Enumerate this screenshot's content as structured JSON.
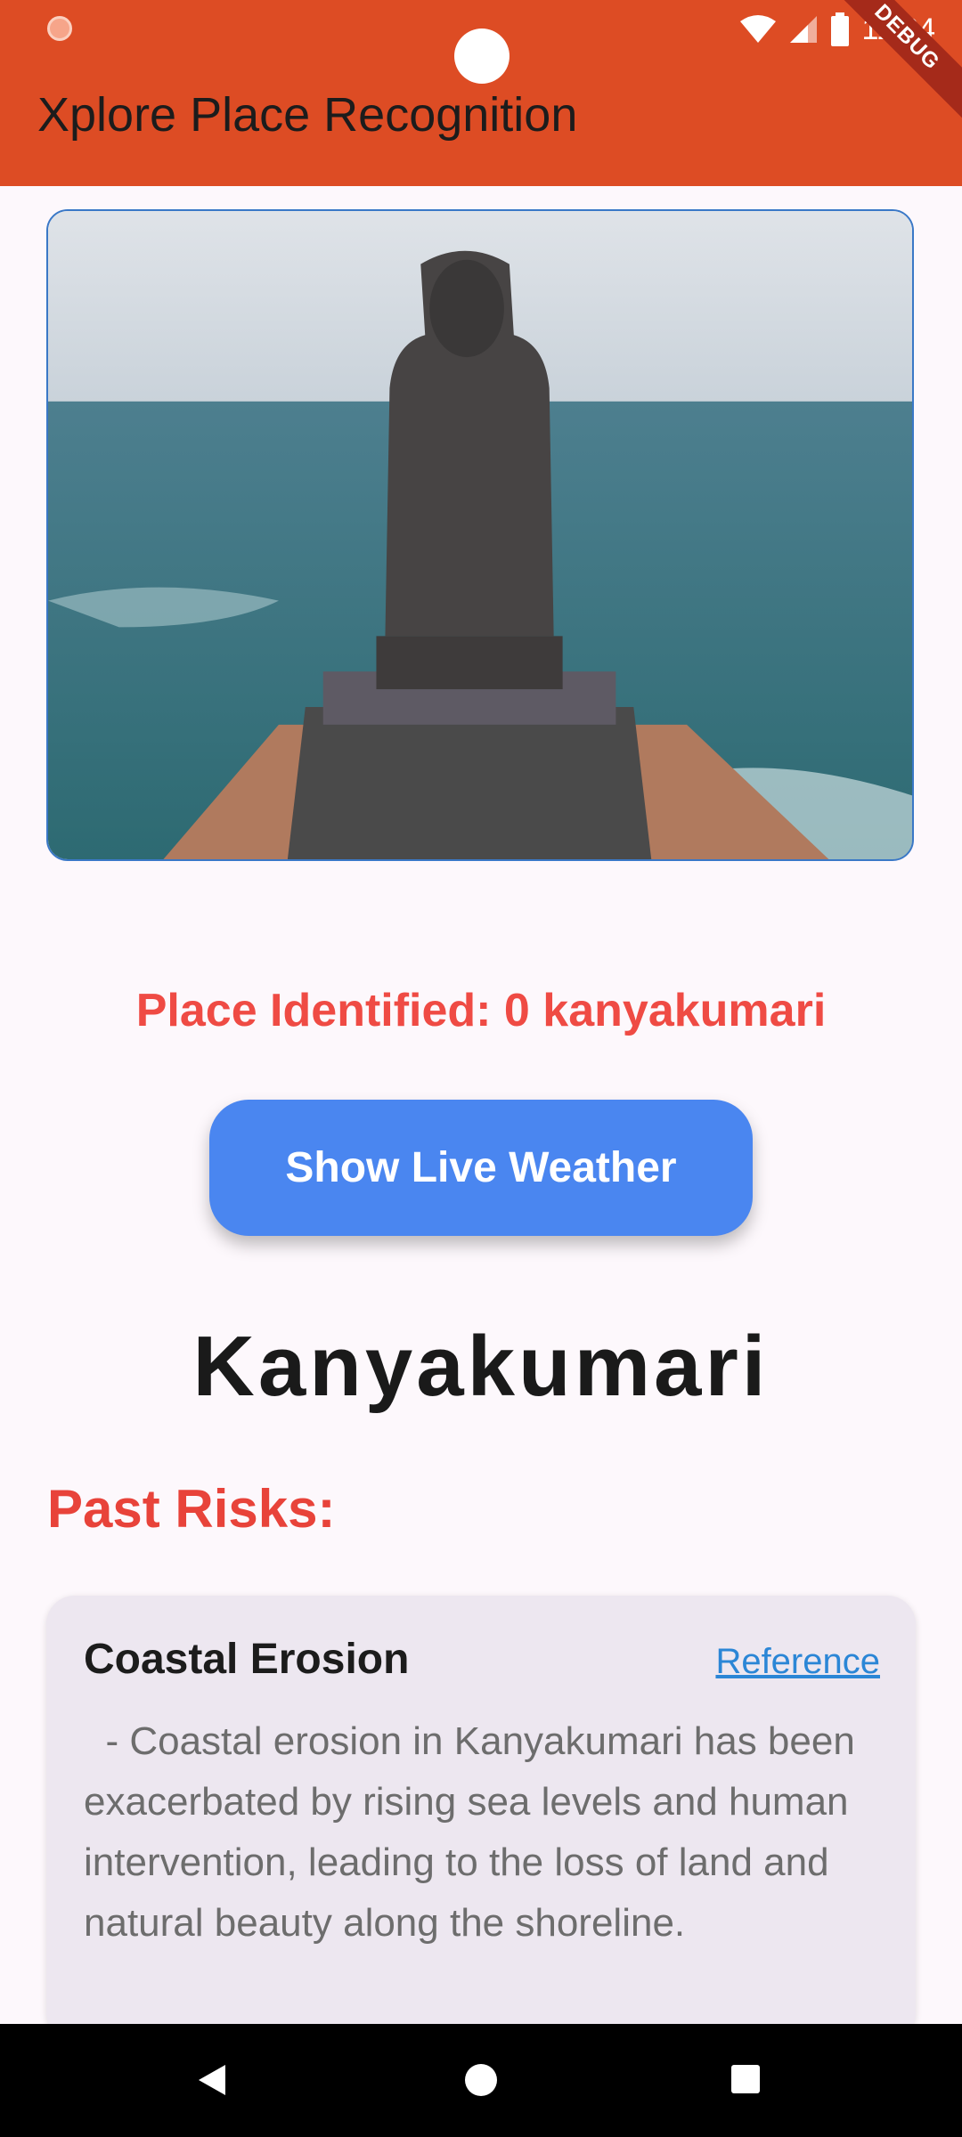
{
  "status_bar": {
    "time": "11:34",
    "debug_banner": "DEBUG"
  },
  "app_bar": {
    "title": "Xplore Place Recognition"
  },
  "main": {
    "identified_text": "Place Identified: 0 kanyakumari",
    "weather_button_label": "Show Live Weather",
    "place_name": "Kanyakumari",
    "risks_heading": "Past Risks:",
    "risks": [
      {
        "title": "Coastal Erosion",
        "reference_label": "Reference",
        "description": "  - Coastal erosion in Kanyakumari has been exacerbated by rising sea levels and human intervention, leading to the loss of land and natural beauty along the shoreline."
      }
    ]
  },
  "colors": {
    "app_bar": "#dd4c24",
    "accent_red": "#ef4b44",
    "button_blue": "#4a86f0",
    "link_blue": "#2b86d6"
  },
  "icons": [
    "wifi-icon",
    "signal-icon",
    "battery-icon",
    "nav-back-icon",
    "nav-home-icon",
    "nav-recents-icon"
  ]
}
